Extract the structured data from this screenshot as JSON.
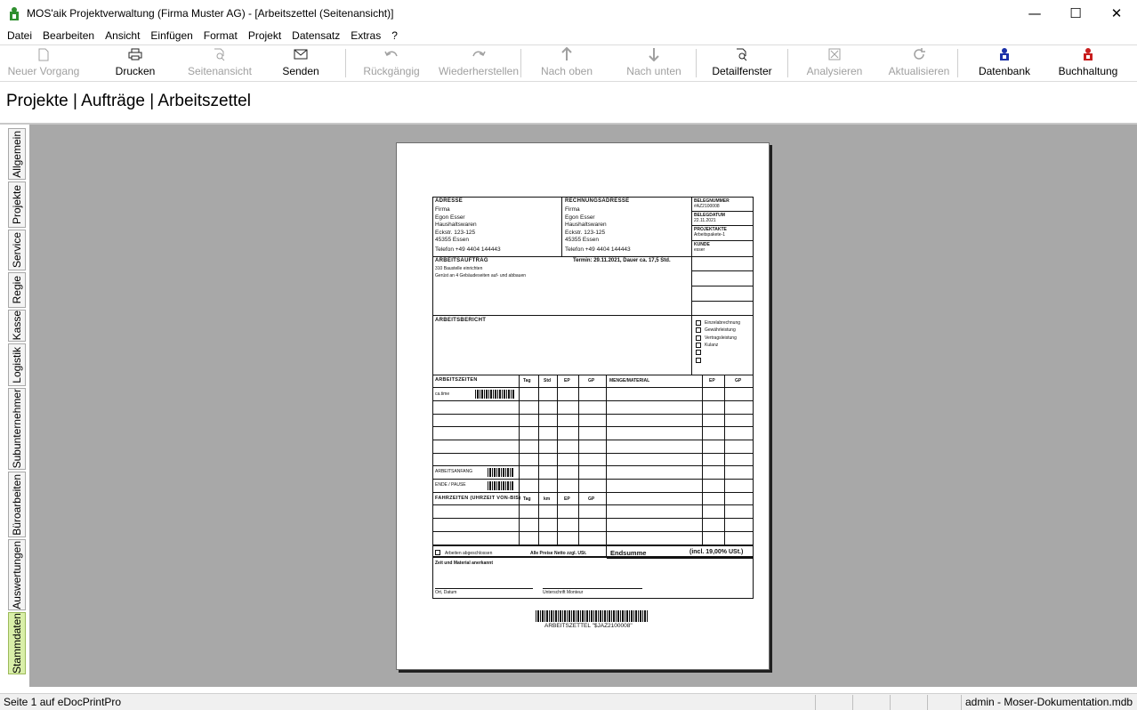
{
  "window": {
    "title": "MOS'aik Projektverwaltung (Firma Muster AG) - [Arbeitszettel (Seitenansicht)]",
    "minimize": "—",
    "maximize": "☐",
    "close": "✕"
  },
  "menu": [
    "Datei",
    "Bearbeiten",
    "Ansicht",
    "Einfügen",
    "Format",
    "Projekt",
    "Datensatz",
    "Extras",
    "?"
  ],
  "toolbar": {
    "new": "Neuer Vorgang",
    "print": "Drucken",
    "preview": "Seitenansicht",
    "send": "Senden",
    "undo": "Rückgängig",
    "redo": "Wiederherstellen",
    "up": "Nach oben",
    "down": "Nach unten",
    "detail": "Detailfenster",
    "analyze": "Analysieren",
    "refresh": "Aktualisieren",
    "database": "Datenbank",
    "accounting": "Buchhaltung"
  },
  "breadcrumb": "Projekte | Aufträge | Arbeitszettel",
  "side_tabs": [
    "Allgemein",
    "Projekte",
    "Service",
    "Regie",
    "Kasse",
    "Logistik",
    "Subunternehmer",
    "Büroarbeiten",
    "Auswertungen",
    "Stammdaten"
  ],
  "status": {
    "page_info": "Seite 1 auf eDocPrintPro",
    "user_db": "admin - Moser-Dokumentation.mdb"
  },
  "document": {
    "address_label": "ADRESSE",
    "address_lines": [
      "Firma",
      "Egon Esser",
      "Haushaltswaren",
      "Eckstr. 123-125",
      "45355 Essen"
    ],
    "address_phone": "Telefon +49 4404 144443",
    "billing_label": "RECHNUNGSADRESSE",
    "billing_lines": [
      "Firma",
      "Egon Esser",
      "Haushaltswaren",
      "Eckstr. 123-125",
      "45355 Essen"
    ],
    "billing_phone": "Telefon +49 4404 144443",
    "belegnummer_label": "BELEGNUMMER",
    "belegnummer": "#AZ2100008",
    "belegdatum_label": "BELEGDATUM",
    "belegdatum": "22.11.2021",
    "projektakte_label": "PROJEKTAKTE",
    "projektakte": "Arbeitspakete-1",
    "kunde_label": "KUNDE",
    "kunde": "esser",
    "auftrag_label": "ARBEITSAUFTRAG",
    "auftrag_termin": "Termin: 29.11.2021, Dauer ca. 17,5 Std.",
    "auftrag_lines": [
      "310 Baustelle einrichten",
      "Gerüst an 4 Gebäudeseiten auf- und abbauen"
    ],
    "bericht_label": "ARBEITSBERICHT",
    "bericht_checks": [
      "Einzelabrechnung",
      "Gewährleistung",
      "Vertragsleistung",
      "Kulanz",
      "",
      ""
    ],
    "arbeitszeiten_label": "ARBEITSZEITEN",
    "col_tag": "Tag",
    "col_std": "Std",
    "col_ep": "EP",
    "col_gp": "GP",
    "col_km": "km",
    "menge_label": "MENGE/MATERIAL",
    "ca_time": "ca.time",
    "arbeitsanfang": "ARBEITSANFANG",
    "ende_pause": "ENDE / PAUSE",
    "fahrzeiten_label": "FAHRZEITEN (UHRZEIT VON-BIS)",
    "arbeiten_abgeschlossen": "Arbeiten abgeschlossen",
    "preise_netto": "Alle Preise Netto zzgl. USt.",
    "endsumme": "Endsumme",
    "endsumme_ust": "(incl. 19,00% USt.)",
    "anerkannt": "Zeit und Material anerkannt",
    "ort_datum": "Ort, Datum",
    "unterschrift": "Unterschrift Monteur",
    "barcode_caption": "ARBEITSZETTEL \"$JAZ2100008\""
  }
}
